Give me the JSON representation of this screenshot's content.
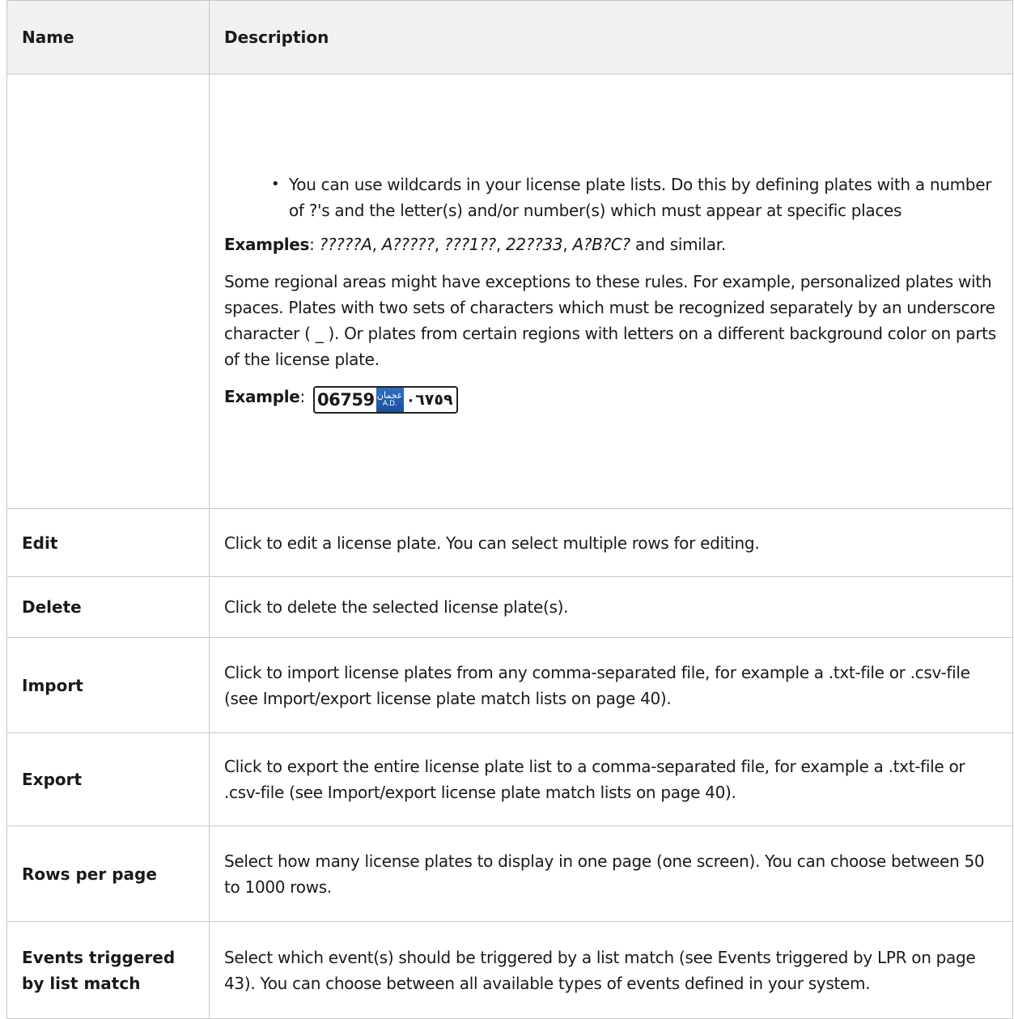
{
  "header": {
    "name": "Name",
    "description": "Description"
  },
  "wildcard_row": {
    "bullet": "You can use wildcards in your license plate lists. Do this by defining plates with a number of ?'s and the letter(s) and/or number(s) which must appear at specific places",
    "examples_label": "Examples",
    "examples_colon": ": ",
    "examples": [
      "?????A",
      "A?????",
      "???1??",
      "22??33",
      "A?B?C?"
    ],
    "examples_sep": ", ",
    "examples_tail": " and similar.",
    "regional_text": "Some regional areas might have exceptions to these rules. For example, personalized plates with spaces. Plates with two sets of characters which must be recognized separately by an underscore character ( _ ). Or plates from certain regions with letters on a different background color on parts of the license plate.",
    "example_label": "Example",
    "example_colon": ": ",
    "plate": {
      "left": "06759",
      "emblem_top": "عجمان",
      "emblem_bottom": "A.D.",
      "right": "٠٦٧٥٩"
    }
  },
  "rows": [
    {
      "name": "Edit",
      "description": "Click to edit a license plate. You can select multiple rows for editing."
    },
    {
      "name": "Delete",
      "description": "Click to delete the selected license plate(s)."
    },
    {
      "name": "Import",
      "description": "Click to import license plates from any comma-separated file, for example a .txt-file or .csv-file (see Import/export license plate match lists on page 40)."
    },
    {
      "name": "Export",
      "description": "Click to export the entire license plate list to a comma-separated file, for example a .txt-file or .csv-file (see Import/export license plate match lists on page 40)."
    },
    {
      "name": "Rows per page",
      "description": "Select how many license plates to display in one page (one screen). You can choose between 50 to 1000 rows."
    },
    {
      "name": "Events triggered by list match",
      "description": "Select which event(s) should be triggered by a list match (see Events triggered by LPR on page 43). You can choose between all available types of events defined in your system."
    }
  ]
}
